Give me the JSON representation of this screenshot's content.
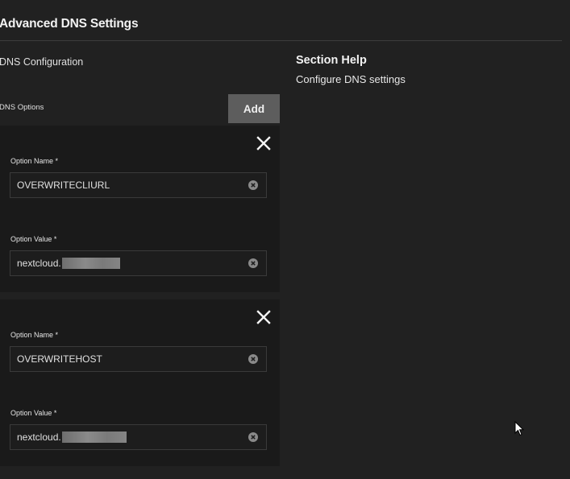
{
  "section": {
    "title": "Advanced DNS Settings",
    "subsection": "DNS Configuration",
    "options_label": "DNS Options",
    "add_label": "Add"
  },
  "options": [
    {
      "name_label": "Option Name *",
      "name_value": "OVERWRITECLIURL",
      "value_label": "Option Value *",
      "value_prefix": "nextcloud.",
      "value_redacted": true
    },
    {
      "name_label": "Option Name *",
      "name_value": "OVERWRITEHOST",
      "value_label": "Option Value *",
      "value_prefix": "nextcloud.",
      "value_redacted": true
    }
  ],
  "help": {
    "title": "Section Help",
    "text": "Configure DNS settings"
  },
  "icons": {
    "remove": "close-icon",
    "clear": "clear-circle-icon",
    "cursor": "mouse-pointer-icon"
  },
  "colors": {
    "background": "#212121",
    "card": "#1a1a1a",
    "button": "#5d5d5d",
    "text": "#e6e6e6"
  }
}
